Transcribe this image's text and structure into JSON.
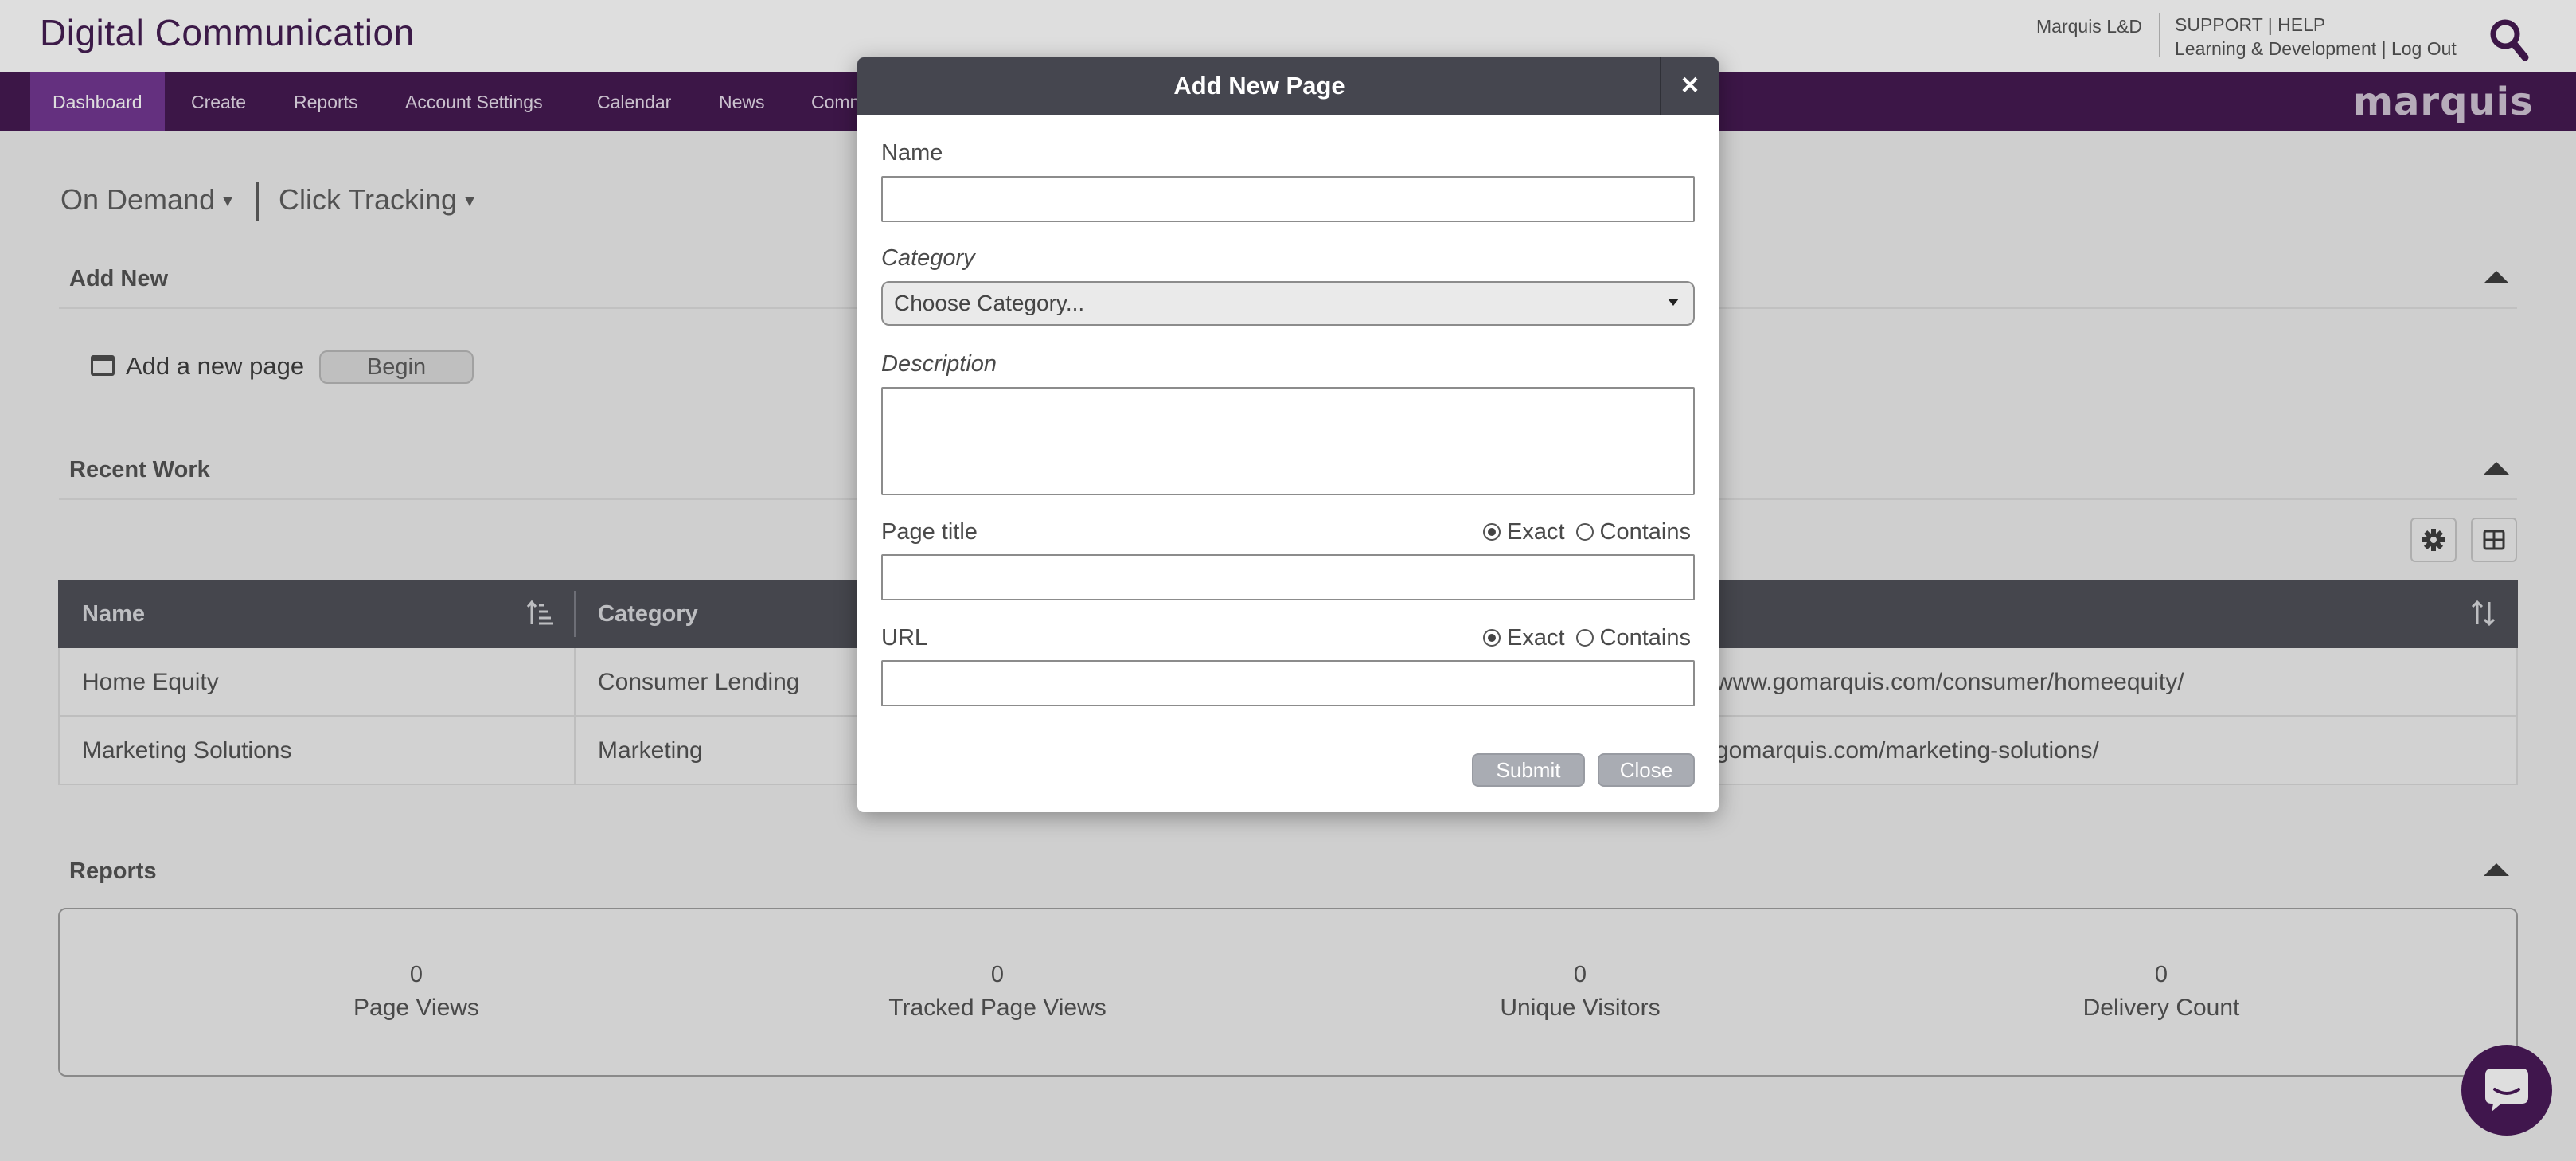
{
  "header": {
    "app_title": "Digital Communication",
    "org_name": "Marquis L&D",
    "links_row1": [
      "SUPPORT",
      "HELP"
    ],
    "links_row2": [
      "Learning & Development",
      "Log Out"
    ],
    "search_icon": "search-icon"
  },
  "nav": {
    "items": [
      {
        "label": "Dashboard",
        "active": true
      },
      {
        "label": "Create"
      },
      {
        "label": "Reports"
      },
      {
        "label": "Account Settings"
      },
      {
        "label": "Calendar"
      },
      {
        "label": "News"
      },
      {
        "label": "Comm"
      }
    ],
    "brand": "marquis",
    "accent": "#3a0b47",
    "active_color": "#6b2b8b"
  },
  "toolbar": {
    "on_demand": "On Demand",
    "click_tracking": "Click Tracking"
  },
  "add_new": {
    "title": "Add New",
    "item_label": "Add a new page",
    "begin": "Begin"
  },
  "recent_work": {
    "title": "Recent Work",
    "columns": [
      "Name",
      "Category"
    ],
    "rows": [
      {
        "name": "Home Equity",
        "category": "Consumer Lending",
        "url": "www.gomarquis.com/consumer/homeequity/"
      },
      {
        "name": "Marketing Solutions",
        "category": "Marketing",
        "url": "gomarquis.com/marketing-solutions/"
      }
    ]
  },
  "reports": {
    "title": "Reports",
    "stats": [
      {
        "value": "0",
        "label": "Page Views"
      },
      {
        "value": "0",
        "label": "Tracked Page Views"
      },
      {
        "value": "0",
        "label": "Unique Visitors"
      },
      {
        "value": "0",
        "label": "Delivery Count"
      }
    ]
  },
  "modal": {
    "title": "Add New Page",
    "close_x": "×",
    "name_label": "Name",
    "name_value": "",
    "category_label": "Category",
    "category_selected": "Choose Category...",
    "description_label": "Description",
    "description_value": "",
    "page_title_label": "Page title",
    "page_title_value": "",
    "url_label": "URL",
    "url_value": "",
    "match_exact": "Exact",
    "match_contains": "Contains",
    "submit": "Submit",
    "close": "Close"
  }
}
